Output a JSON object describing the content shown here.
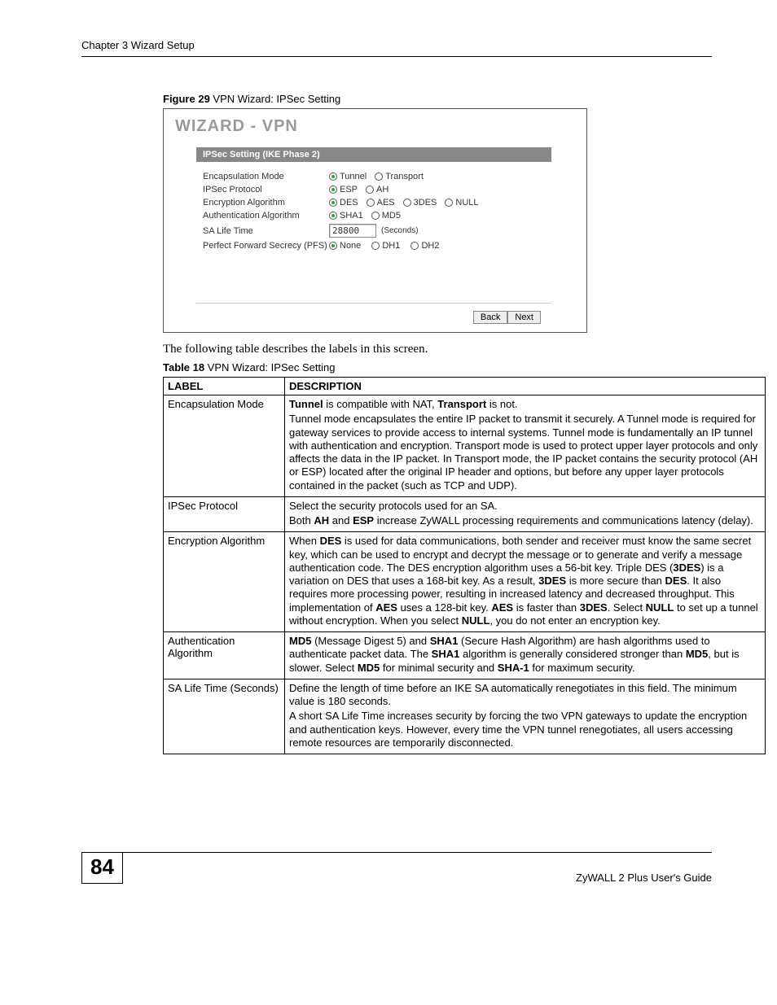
{
  "header": {
    "chapter": "Chapter 3 Wizard Setup"
  },
  "figure": {
    "caption_strong": "Figure 29",
    "caption_rest": "   VPN Wizard: IPSec Setting",
    "wizard_title": "WIZARD - VPN",
    "panel_title": "IPSec Setting (IKE Phase 2)",
    "rows": {
      "encap": {
        "label": "Encapsulation Mode",
        "o1": "Tunnel",
        "o2": "Transport"
      },
      "proto": {
        "label": "IPSec Protocol",
        "o1": "ESP",
        "o2": "AH"
      },
      "encalg": {
        "label": "Encryption Algorithm",
        "o1": "DES",
        "o2": "AES",
        "o3": "3DES",
        "o4": "NULL"
      },
      "authalg": {
        "label": "Authentication Algorithm",
        "o1": "SHA1",
        "o2": "MD5"
      },
      "salife": {
        "label": "SA Life Time",
        "value": "28800",
        "unit": "(Seconds)"
      },
      "pfs": {
        "label": "Perfect Forward Secrecy (PFS)",
        "o1": "None",
        "o2": "DH1",
        "o3": "DH2"
      }
    },
    "buttons": {
      "back": "Back",
      "next": "Next"
    }
  },
  "following_text": "The following table describes the labels in this screen.",
  "table_caption": {
    "strong": "Table 18",
    "rest": "   VPN Wizard: IPSec Setting"
  },
  "table": {
    "head_label": "LABEL",
    "head_desc": "DESCRIPTION",
    "rows": [
      {
        "label": "Encapsulation Mode",
        "desc_html": "<p><b>Tunnel</b> is compatible with NAT, <b>Transport</b> is not.</p><p>Tunnel mode encapsulates the entire IP packet to transmit it securely. A Tunnel mode is required for gateway services to provide access to internal systems. Tunnel mode is fundamentally an IP tunnel with authentication and encryption. Transport mode is used to protect upper layer protocols and only affects the data in the IP packet. In Transport mode, the IP packet contains the security protocol (AH or ESP) located after the original IP header and options, but before any upper layer protocols contained in the packet (such as TCP and UDP).</p>"
      },
      {
        "label": "IPSec Protocol",
        "desc_html": "<p>Select the security protocols used for an SA.</p><p>Both <b>AH</b> and <b>ESP</b> increase ZyWALL processing requirements and communications latency (delay).</p>"
      },
      {
        "label": "Encryption Algorithm",
        "desc_html": "<p>When <b>DES</b> is used for data communications, both sender and receiver must know the same secret key, which can be used to encrypt and decrypt the message or to generate and verify a message authentication code. The DES encryption algorithm uses a 56-bit key. Triple DES (<b>3DES</b>) is a variation on DES that uses a 168-bit key. As a result, <b>3DES</b> is more secure than <b>DES</b>. It also requires more processing power, resulting in increased latency and decreased throughput. This implementation of <b>AES</b> uses a 128-bit key. <b>AES</b> is faster than <b>3DES</b>. Select <b>NULL</b> to set up a tunnel without encryption. When you select <b>NULL</b>, you do not enter an encryption key.</p>"
      },
      {
        "label": "Authentication Algorithm",
        "desc_html": "<p><b>MD5</b> (Message Digest 5) and <b>SHA1</b> (Secure Hash Algorithm) are hash algorithms used to authenticate packet data. The <b>SHA1</b> algorithm is generally considered stronger than <b>MD5</b>, but is slower. Select <b>MD5</b> for minimal security and <b>SHA-1</b> for maximum security.</p>"
      },
      {
        "label": "SA Life Time (Seconds)",
        "desc_html": "<p>Define the length of time before an IKE SA automatically renegotiates in this field. The minimum value is 180 seconds.</p><p>A short SA Life Time increases security by forcing the two VPN gateways to update the encryption and authentication keys. However, every time the VPN tunnel renegotiates, all users accessing remote resources are temporarily disconnected.</p>"
      }
    ]
  },
  "footer": {
    "page_num": "84",
    "guide": "ZyWALL 2 Plus User's Guide"
  }
}
